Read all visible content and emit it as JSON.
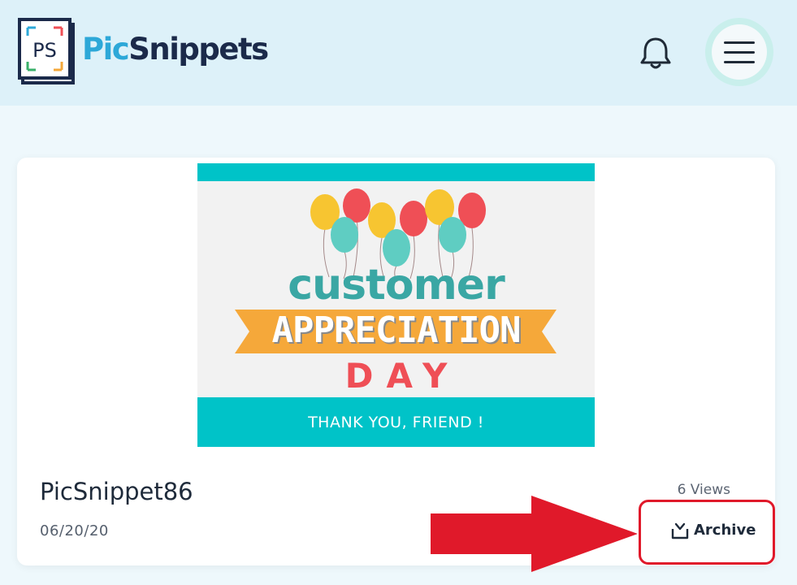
{
  "header": {
    "logo_letters": "PS",
    "brand_part1": "Pic",
    "brand_part2": "Snippets",
    "icons": {
      "notifications": "bell-icon",
      "menu": "hamburger-menu-icon"
    }
  },
  "snippet": {
    "image": {
      "line1": "customer",
      "line2": "APPRECIATION",
      "line3": "DAY",
      "footer": "THANK YOU,  FRIEND !"
    },
    "title": "PicSnippet86",
    "date": "06/20/20",
    "views": "6 Views",
    "archive_label": "Archive",
    "archive_icon": "archive-tray-icon"
  },
  "colors": {
    "brand_blue": "#2da8d8",
    "brand_navy": "#1b2a4a",
    "header_bg": "#ddf1f9",
    "image_teal": "#00c3c8",
    "ribbon_orange": "#f5a83a",
    "annotation_red": "#e0192a"
  }
}
